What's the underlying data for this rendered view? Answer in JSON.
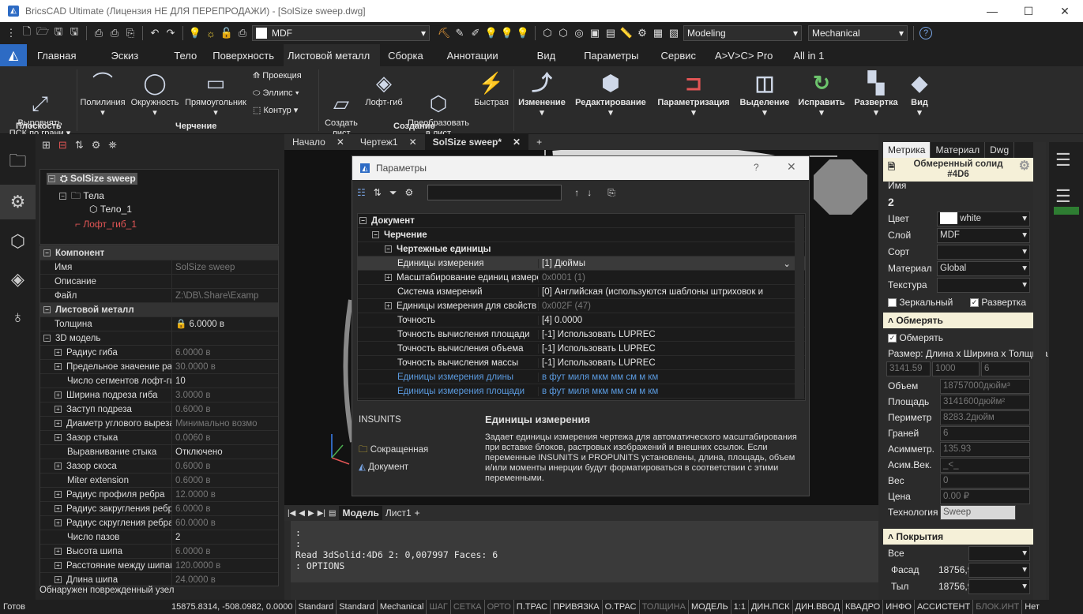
{
  "window": {
    "title": "BricsCAD Ultimate (Лицензия НЕ ДЛЯ ПЕРЕПРОДАЖИ) - [SolSize sweep.dwg]",
    "minimize": "—",
    "maximize": "☐",
    "close": "✕"
  },
  "qat": {
    "layer": "MDF",
    "workspace": "Modeling",
    "profile": "Mechanical"
  },
  "ribbon_tabs": [
    "Главная",
    "Эскиз",
    "Тело",
    "Поверхность",
    "Листовой металл",
    "Сборка",
    "Аннотации",
    "Вид",
    "Параметры",
    "Сервис",
    "A>V>C> Pro",
    "All in 1"
  ],
  "ribbon": {
    "align": "Выровнять\nПСК по грани ▾",
    "group_plane": "Плоскость",
    "polyline": "Полилиния",
    "circle": "Окружность",
    "rectangle": "Прямоугольник",
    "projection": "Проекция",
    "ellipse": "Эллипс",
    "contour": "Контур",
    "group_draw": "Черчение",
    "create_sheet": "Создать\nлист",
    "loft_bend": "Лофт-гиб",
    "convert": "Преобразовать\nв лист",
    "fast": "Быстрая",
    "group_create": "Создание",
    "change": "Изменение",
    "edit": "Редактирование",
    "param": "Параметризация",
    "select": "Выделение",
    "fix": "Исправить",
    "unfold": "Развертка",
    "view": "Вид"
  },
  "tree": {
    "root": "SolSize sweep",
    "bodies": "Тела",
    "body1": "Тело_1",
    "loft": "Лофт_гиб_1"
  },
  "props": {
    "component": "Компонент",
    "rows1": [
      [
        "Имя",
        "SolSize sweep",
        true
      ],
      [
        "Описание",
        "",
        false
      ],
      [
        "Файл",
        "Z:\\DB\\.Share\\Examp",
        true
      ]
    ],
    "sheet": "Листовой металл",
    "thickness_k": "Толщина",
    "thickness_v": "6.0000 в",
    "model3d": "3D модель",
    "rows2": [
      [
        "Радиус гиба",
        "6.0000 в",
        true,
        true
      ],
      [
        "Предельное значение радиу",
        "30.0000 в",
        true,
        true
      ],
      [
        "Число сегментов лофт-гиба",
        "10",
        false,
        false
      ],
      [
        "Ширина подреза гиба",
        "3.0000 в",
        true,
        true
      ],
      [
        "Заступ подреза",
        "0.6000 в",
        true,
        true
      ],
      [
        "Диаметр углового выреза",
        "Минимально возмо",
        true,
        true
      ],
      [
        "Зазор стыка",
        "0.0060 в",
        true,
        true
      ],
      [
        "Выравнивание стыка",
        "Отключено",
        false,
        false
      ],
      [
        "Зазор скоса",
        "0.6000 в",
        true,
        true
      ],
      [
        "Miter extension",
        "0.6000 в",
        true,
        false
      ],
      [
        "Радиус профиля ребра",
        "12.0000 в",
        true,
        true
      ],
      [
        "Радиус закругления ребра",
        "6.0000 в",
        true,
        true
      ],
      [
        "Радиус скругления ребра",
        "60.0000 в",
        true,
        true
      ],
      [
        "Число пазов",
        "2",
        false,
        false
      ],
      [
        "Высота шипа",
        "6.0000 в",
        true,
        true
      ],
      [
        "Расстояние между шипами",
        "120.0000 в",
        true,
        true
      ],
      [
        "Длина шипа",
        "24.0000 в",
        true,
        true
      ]
    ],
    "status": "Обнаружен поврежденный узел"
  },
  "doc_tabs": [
    "Начало",
    "Чертеж1",
    "SolSize sweep*"
  ],
  "model_tabs": [
    "Модель",
    "Лист1"
  ],
  "cmd": {
    "lines": [
      ":",
      ":",
      "Read 3dSolid:4D6 2: 0,007997 Faces: 6",
      ": OPTIONS"
    ]
  },
  "dialog": {
    "title": "Параметры",
    "help": "?",
    "rows": [
      [
        "cat0",
        "Документ",
        ""
      ],
      [
        "cat1",
        "Черчение",
        ""
      ],
      [
        "cat2",
        "Чертежные единицы",
        ""
      ],
      [
        "sel",
        "Единицы измерения",
        "[1] Дюймы"
      ],
      [
        "g",
        "Масштабирование единиц измерения при вс",
        "0x0001 (1)"
      ],
      [
        "n",
        "Система измерений",
        "[0] Английская (используются шаблоны штриховок и"
      ],
      [
        "g",
        "Единицы измерения для свойств",
        "0x002F (47)"
      ],
      [
        "n",
        "Точность",
        "[4] 0.0000"
      ],
      [
        "n",
        "Точность вычисления площади",
        "[-1] Использовать LUPREC"
      ],
      [
        "n",
        "Точность вычисления объема",
        "[-1] Использовать LUPREC"
      ],
      [
        "n",
        "Точность вычисления массы",
        "[-1] Использовать LUPREC"
      ],
      [
        "blue",
        "Единицы измерения длины",
        "в фут миля мкм мм см м км"
      ],
      [
        "blue",
        "Единицы измерения площади",
        "в фут миля мкм мм см м км"
      ]
    ],
    "varname": "INSUNITS",
    "short": "Сокращенная",
    "doc": "Документ",
    "desc_title": "Единицы измерения",
    "desc": "Задает единицы измерения чертежа для автоматического масштабирования при вставке блоков, растровых изображений и внешних ссылок. Если переменные INSUNITS и PROPUNITS установлены, длина, площадь, объем и/или моменты инерции будут форматироваться в соответствии с этими переменными."
  },
  "right": {
    "tabs": [
      "Метрика",
      "Материал",
      "Dwg"
    ],
    "header": "Обмеренный солид\n#4D6",
    "name_k": "Имя",
    "name_v": "2",
    "color_k": "Цвет",
    "color_v": "white",
    "layer_k": "Слой",
    "layer_v": "MDF",
    "sort_k": "Сорт",
    "mat_k": "Материал",
    "mat_v": "Global",
    "tex_k": "Текстура",
    "mirror": "Зеркальный",
    "unfold": "Развертка",
    "measure_sec": "Обмерять",
    "measure_chk": "Обмерять",
    "size_lbl": "Размер: Длина x Ширина x Толщина",
    "dims": [
      "3141.59",
      "1000",
      "6"
    ],
    "metrics": [
      [
        "Объем",
        "18757000дюйм³"
      ],
      [
        "Площадь",
        "3141600дюйм²"
      ],
      [
        "Периметр",
        "8283.2дюйм"
      ],
      [
        "Граней",
        "6"
      ],
      [
        "Асимметр.",
        "135.93"
      ],
      [
        "Асим.Век.",
        "_<_"
      ],
      [
        "Вес",
        "0"
      ],
      [
        "Цена",
        "0.00 ₽"
      ],
      [
        "Технология",
        "Sweep"
      ]
    ],
    "cover_sec": "Покрытия",
    "cover": [
      [
        "Все",
        ""
      ],
      [
        "Фасад",
        "18756,9"
      ],
      [
        "Тыл",
        "18756,9"
      ]
    ]
  },
  "status": {
    "ready": "Готов",
    "coords": "15875.8314, -508.0982, 0.0000",
    "items": [
      [
        "Standard",
        false
      ],
      [
        "Standard",
        false
      ],
      [
        "Mechanical",
        false
      ],
      [
        "ШАГ",
        true
      ],
      [
        "СЕТКА",
        true
      ],
      [
        "ОРТО",
        true
      ],
      [
        "П.ТРАС",
        false
      ],
      [
        "ПРИВЯЗКА",
        false
      ],
      [
        "О.ТРАС",
        false
      ],
      [
        "ТОЛЩИНА",
        true
      ],
      [
        "МОДЕЛЬ",
        false
      ],
      [
        "1:1",
        false
      ],
      [
        "ДИН.ПСК",
        false
      ],
      [
        "ДИН.ВВОД",
        false
      ],
      [
        "КВАДРО",
        false
      ],
      [
        "ИНФО",
        false
      ],
      [
        "АССИСТЕНТ",
        false
      ],
      [
        "БЛОК.ИНТ",
        true
      ],
      [
        "Нет",
        false
      ]
    ]
  }
}
